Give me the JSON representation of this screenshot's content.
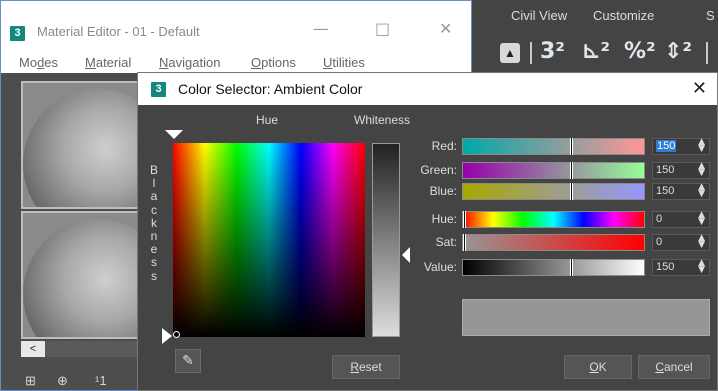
{
  "max_menu": {
    "items": [
      "Civil View",
      "Customize",
      "S"
    ]
  },
  "max_toolbar": {
    "icons": [
      "undo-arrow-icon",
      "snap-3d-icon",
      "angle-snap-icon",
      "percent-snap-icon",
      "spinner-snap-icon"
    ],
    "glyphs": {
      "snap": "3²",
      "angle": "⊾²",
      "percent": "%²",
      "spinner": "⇕²"
    }
  },
  "material_editor": {
    "logo": "3",
    "title": "Material Editor - 01 - Default",
    "controls": {
      "minimize": "—",
      "maximize": "□",
      "close": "✕"
    },
    "menu": [
      {
        "pre": "Mo",
        "ul": "d",
        "post": "es"
      },
      {
        "pre": "",
        "ul": "M",
        "post": "aterial"
      },
      {
        "pre": "",
        "ul": "N",
        "post": "avigation"
      },
      {
        "pre": "",
        "ul": "O",
        "post": "ptions"
      },
      {
        "pre": "",
        "ul": "U",
        "post": "tilities"
      }
    ],
    "scroll_left_glyph": "<",
    "bottom_icons": [
      "⊞",
      "⊕",
      "¹1"
    ]
  },
  "color_selector": {
    "logo": "3",
    "title": "Color Selector: Ambient Color",
    "close_glyph": "✕",
    "hue_label": "Hue",
    "whiteness_label": "Whiteness",
    "blackness_letters": [
      "B",
      "l",
      "a",
      "c",
      "k",
      "n",
      "e",
      "s",
      "s"
    ],
    "rows": [
      {
        "label": "Red:",
        "value": "150",
        "selected": true,
        "thumb": 0.59,
        "gradient": "linear-gradient(to right, #00a8a8, #ff9696)"
      },
      {
        "label": "Green:",
        "value": "150",
        "selected": false,
        "thumb": 0.59,
        "gradient": "linear-gradient(to right, #9600a8, #96ff96)"
      },
      {
        "label": "Blue:",
        "value": "150",
        "selected": false,
        "thumb": 0.59,
        "gradient": "linear-gradient(to right, #a8a800, #9696ff)"
      },
      {
        "label": "Hue:",
        "value": "0",
        "selected": false,
        "thumb": 0.0,
        "gradient": "linear-gradient(to right, #ff0000, #ffff00, #00ff00, #00ffff, #0000ff, #ff00ff, #ff0000)"
      },
      {
        "label": "Sat:",
        "value": "0",
        "selected": false,
        "thumb": 0.0,
        "gradient": "linear-gradient(to right, #969696, #ff0000)"
      },
      {
        "label": "Value:",
        "value": "150",
        "selected": false,
        "thumb": 0.59,
        "gradient": "linear-gradient(to right, #000000, #ffffff)"
      }
    ],
    "spin_up": "▲",
    "spin_down": "▼",
    "preview_color": "#969696",
    "eyedropper_glyph": "✎",
    "reset": {
      "ul": "R",
      "post": "eset"
    },
    "ok": {
      "ul": "O",
      "post": "K"
    },
    "cancel": {
      "ul": "C",
      "post": "ancel"
    }
  }
}
